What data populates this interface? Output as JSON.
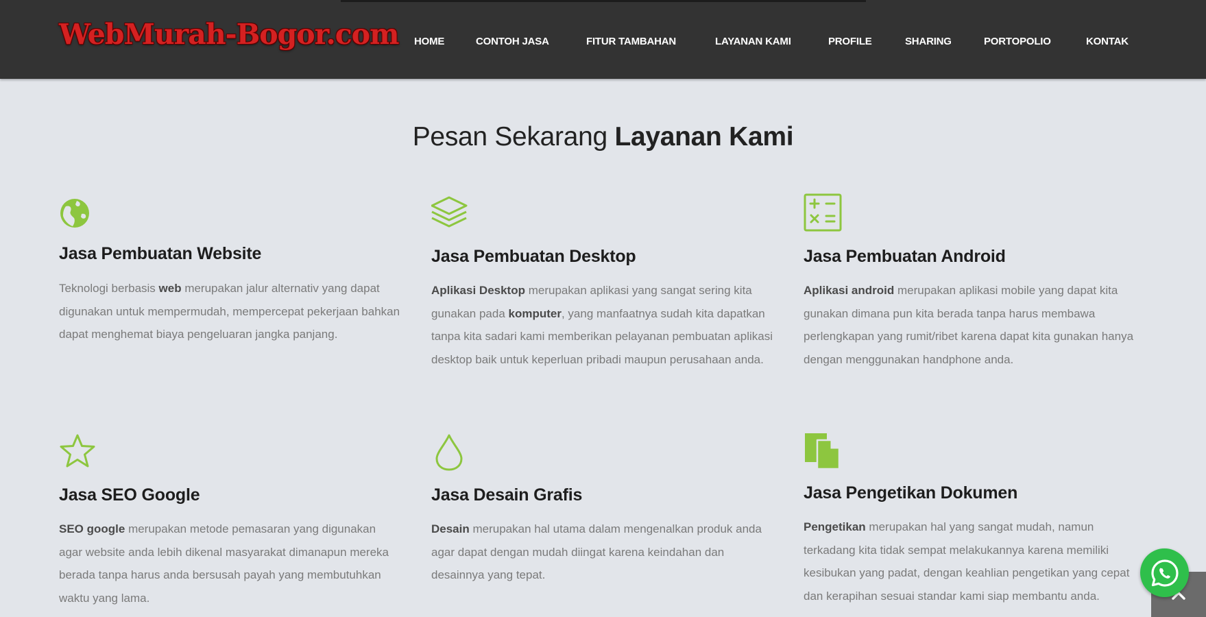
{
  "header": {
    "logo_text": "WebMurah-Bogor.com",
    "nav": [
      "HOME",
      "CONTOH JASA",
      "FITUR TAMBAHAN",
      "LAYANAN KAMI",
      "PROFILE",
      "SHARING",
      "PORTOPOLIO",
      "KONTAK"
    ]
  },
  "section": {
    "title_light": "Pesan Sekarang",
    "title_bold": "Layanan Kami"
  },
  "services": [
    {
      "icon": "globe-icon",
      "title": "Jasa Pembuatan Website",
      "desc": [
        {
          "t": "Teknologi berbasis ",
          "b": false
        },
        {
          "t": "web",
          "b": true
        },
        {
          "t": " merupakan jalur alternativ yang dapat digunakan untuk mempermudah, mempercepat pekerjaan bahkan dapat menghemat biaya pengeluaran jangka panjang.",
          "b": false
        }
      ]
    },
    {
      "icon": "layers-icon",
      "title": "Jasa Pembuatan Desktop",
      "desc": [
        {
          "t": "Aplikasi Desktop",
          "b": true
        },
        {
          "t": " merupakan aplikasi yang sangat sering kita gunakan pada ",
          "b": false
        },
        {
          "t": "komputer",
          "b": true
        },
        {
          "t": ", yang manfaatnya sudah kita dapatkan tanpa kita sadari kami memberikan pelayanan pembuatan aplikasi desktop baik untuk keperluan pribadi maupun perusahaan anda.",
          "b": false
        }
      ]
    },
    {
      "icon": "calculator-icon",
      "title": "Jasa Pembuatan Android",
      "desc": [
        {
          "t": "Aplikasi android",
          "b": true
        },
        {
          "t": " merupakan aplikasi mobile yang dapat kita gunakan dimana pun kita berada tanpa harus membawa perlengkapan yang rumit/ribet karena dapat kita gunakan hanya dengan menggunakan handphone anda.",
          "b": false
        }
      ]
    },
    {
      "icon": "star-icon",
      "title": "Jasa SEO Google",
      "desc": [
        {
          "t": "SEO google",
          "b": true
        },
        {
          "t": " merupakan metode pemasaran yang digunakan agar website anda lebih dikenal masyarakat dimanapun mereka berada tanpa harus anda bersusah payah yang membutuhkan waktu yang lama.",
          "b": false
        }
      ]
    },
    {
      "icon": "droplet-icon",
      "title": "Jasa Desain Grafis",
      "desc": [
        {
          "t": "Desain",
          "b": true
        },
        {
          "t": " merupakan hal utama dalam mengenalkan produk anda agar dapat dengan mudah diingat karena keindahan dan desainnya yang tepat.",
          "b": false
        }
      ]
    },
    {
      "icon": "documents-icon",
      "title": "Jasa Pengetikan Dokumen",
      "desc": [
        {
          "t": "Pengetikan",
          "b": true
        },
        {
          "t": " merupakan hal yang sangat mudah, namun terkadang kita tidak sempat melakukannya karena memiliki kesibukan yang padat, dengan keahlian pengetikan yang cepat dan kerapihan sesuai standar kami siap membantu anda.",
          "b": false
        }
      ]
    }
  ],
  "colors": {
    "header_bg": "#333333",
    "page_bg": "#e2e5ea",
    "accent_green": "#8dc63f",
    "logo_red": "#d42121",
    "whatsapp": "#2fbf4b"
  },
  "floating": {
    "whatsapp_icon": "whatsapp-icon",
    "back_to_top_icon": "chevron-up-icon"
  }
}
